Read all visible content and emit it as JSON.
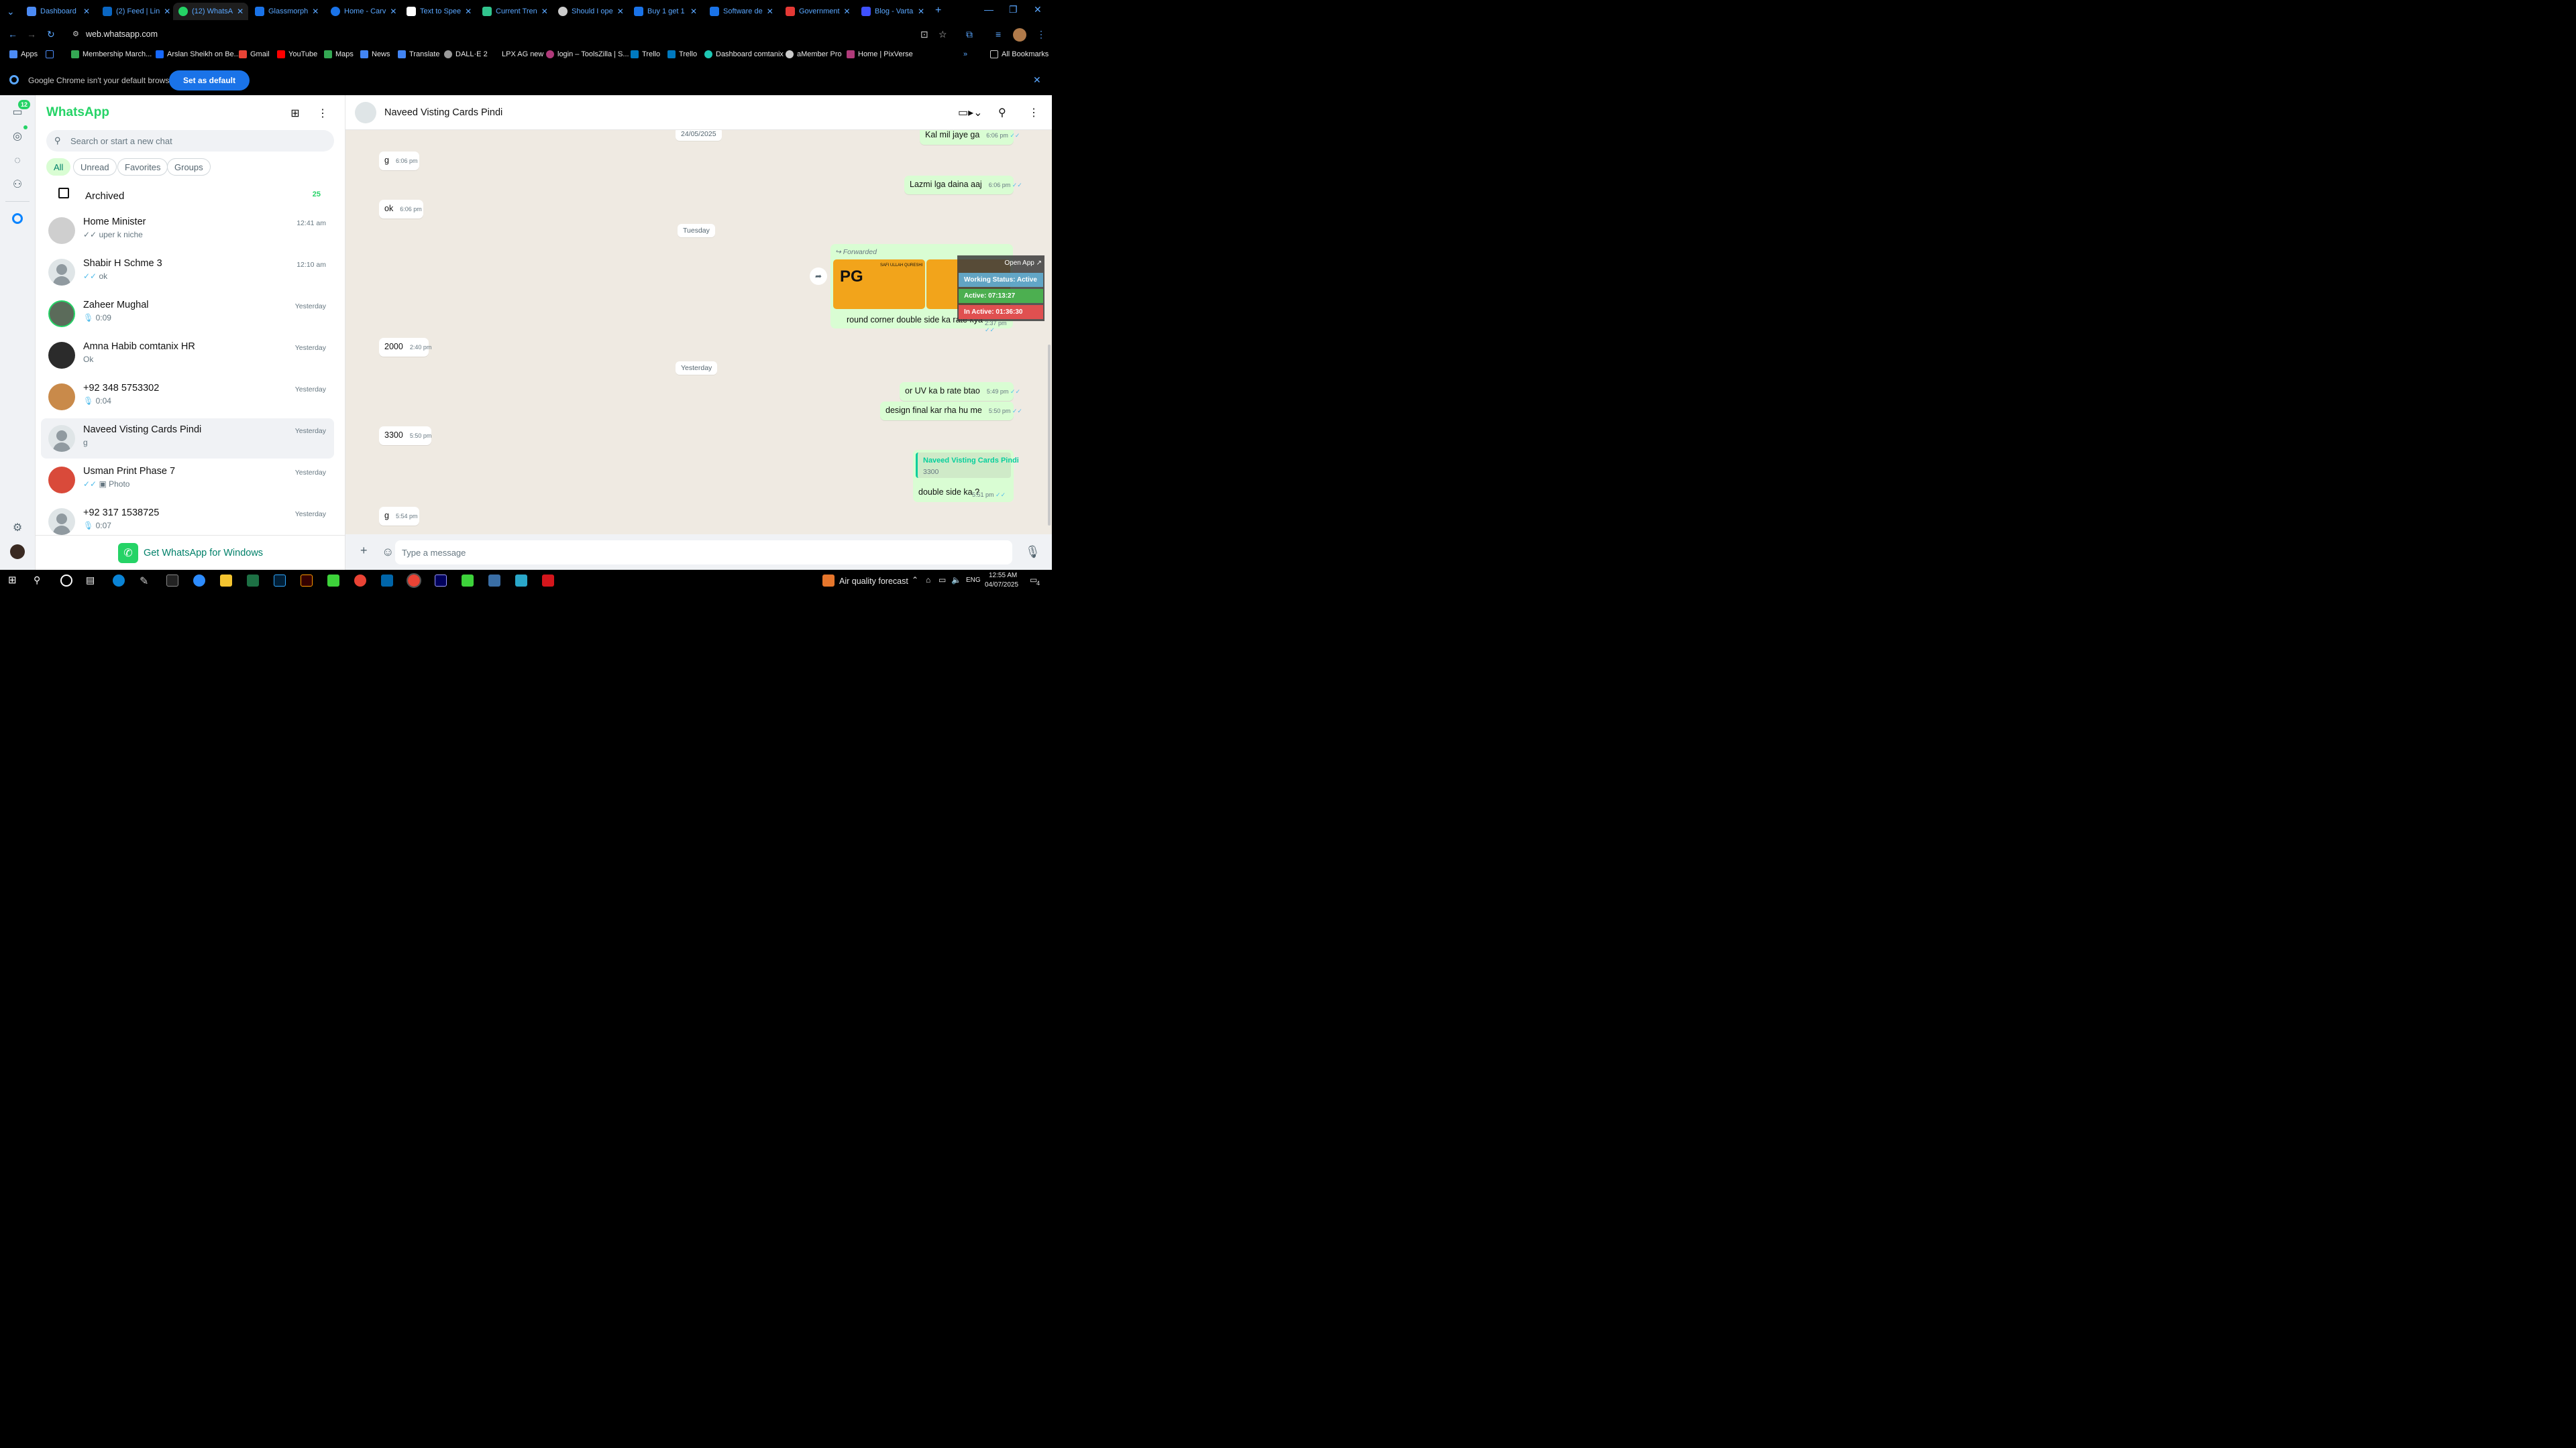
{
  "browser": {
    "tabs": [
      {
        "label": "Dashboard",
        "color": "#4c8bf5"
      },
      {
        "label": "(2) Feed | Lin",
        "color": "#0a66c2"
      },
      {
        "label": "(12) WhatsA",
        "color": "#25d366"
      },
      {
        "label": "Glassmorph",
        "color": "#1a73e8"
      },
      {
        "label": "Home - Carv",
        "color": "#1a73e8"
      },
      {
        "label": "Text to Spee",
        "color": "#ffffff"
      },
      {
        "label": "Current Tren",
        "color": "#31c48d"
      },
      {
        "label": "Should I ope",
        "color": "#cccccc"
      },
      {
        "label": "Buy 1 get 1",
        "color": "#1a73e8"
      },
      {
        "label": "Software de",
        "color": "#1a73e8"
      },
      {
        "label": "Government",
        "color": "#e53935"
      },
      {
        "label": "Blog - Varta",
        "color": "#3f51ff"
      }
    ],
    "url": "web.whatsapp.com",
    "bookmarks": [
      {
        "label": "Apps",
        "color": "#4c8bf5"
      },
      {
        "label": "Membership March...",
        "color": "#34a853"
      },
      {
        "label": "Arslan Sheikh on Be...",
        "color": "#1769ff"
      },
      {
        "label": "Gmail",
        "color": "#ea4335"
      },
      {
        "label": "YouTube",
        "color": "#ff0000"
      },
      {
        "label": "Maps",
        "color": "#34a853"
      },
      {
        "label": "News",
        "color": "#4285f4"
      },
      {
        "label": "Translate",
        "color": "#4285f4"
      },
      {
        "label": "DALL·E 2",
        "color": "#999999"
      },
      {
        "label": "LPX AG new",
        "color": "#000000"
      },
      {
        "label": "login – ToolsZilla | S...",
        "color": "#b03a7a"
      },
      {
        "label": "Trello",
        "color": "#0079bf"
      },
      {
        "label": "Trello",
        "color": "#0079bf"
      },
      {
        "label": "Dashboard comtanix",
        "color": "#1ec7b4"
      },
      {
        "label": "aMember Pro",
        "color": "#cccccc"
      },
      {
        "label": "Home | PixVerse",
        "color": "#b03a7a"
      }
    ],
    "all_bookmarks": "All Bookmarks",
    "infobar": {
      "message": "Google Chrome isn't your default browser",
      "button": "Set as default"
    }
  },
  "whatsapp": {
    "brand": "WhatsApp",
    "unread_badge": "12",
    "search_placeholder": "Search or start a new chat",
    "filters": [
      "All",
      "Unread",
      "Favorites",
      "Groups"
    ],
    "archived": {
      "label": "Archived",
      "count": "25"
    },
    "chats": [
      {
        "name": "Home Minister",
        "preview": "uper k niche",
        "time": "12:41 am",
        "prefix": "ticks"
      },
      {
        "name": "Shabir H  Schme 3",
        "preview": "ok",
        "time": "12:10 am",
        "prefix": "ticks"
      },
      {
        "name": "Zaheer Mughal",
        "preview": "0:09",
        "time": "Yesterday",
        "prefix": "mic"
      },
      {
        "name": "Amna Habib comtanix HR",
        "preview": "Ok",
        "time": "Yesterday",
        "prefix": ""
      },
      {
        "name": "+92 348 5753302",
        "preview": "0:04",
        "time": "Yesterday",
        "prefix": "mic"
      },
      {
        "name": "Naveed Visting Cards Pindi",
        "preview": "g",
        "time": "Yesterday",
        "prefix": ""
      },
      {
        "name": "Usman Print Phase 7",
        "preview": "Photo",
        "time": "Yesterday",
        "prefix": "ticks-photo"
      },
      {
        "name": "+92 317 1538725",
        "preview": "0:07",
        "time": "Yesterday",
        "prefix": "mic"
      }
    ],
    "get_windows": "Get WhatsApp for Windows",
    "conversation": {
      "title": "Naveed Visting Cards Pindi",
      "dates": [
        "24/05/2025",
        "Tuesday",
        "Yesterday"
      ],
      "messages": [
        {
          "text": "Kal mil jaye ga",
          "time": "6:06 pm",
          "dir": "out"
        },
        {
          "text": "g",
          "time": "6:06 pm",
          "dir": "in"
        },
        {
          "text": "Lazmi lga daina aaj",
          "time": "6:06 pm",
          "dir": "out"
        },
        {
          "text": "ok",
          "time": "6:06 pm",
          "dir": "in"
        },
        {
          "text": "2000",
          "time": "2:40 pm",
          "dir": "in"
        },
        {
          "text": "or UV ka b rate btao",
          "time": "5:49 pm",
          "dir": "out"
        },
        {
          "text": "design final kar rha hu me",
          "time": "5:50 pm",
          "dir": "out"
        },
        {
          "text": "3300",
          "time": "5:50 pm",
          "dir": "in"
        },
        {
          "text": "g",
          "time": "5:54 pm",
          "dir": "in"
        }
      ],
      "forwarded": {
        "label": "Forwarded",
        "card_brand": "PG",
        "card_name": "SAFI ULLAH QURESHI",
        "caption": "round corner double side ka rate kya",
        "time": "2:37 pm"
      },
      "overlay": {
        "open_app": "Open App ↗",
        "status": "Working Status: Active",
        "active": "Active: 07:13:27",
        "inactive": "In Active: 01:36:30"
      },
      "reply": {
        "quoted_name": "Naveed Visting Cards Pindi",
        "quoted_text": "3300",
        "text": "double side ka ?",
        "time": "5:51 pm"
      },
      "compose_placeholder": "Type a message"
    }
  },
  "taskbar": {
    "weather": "Air quality forecast",
    "lang": "ENG",
    "time": "12:55 AM",
    "date": "04/07/2025",
    "notif": "4"
  }
}
